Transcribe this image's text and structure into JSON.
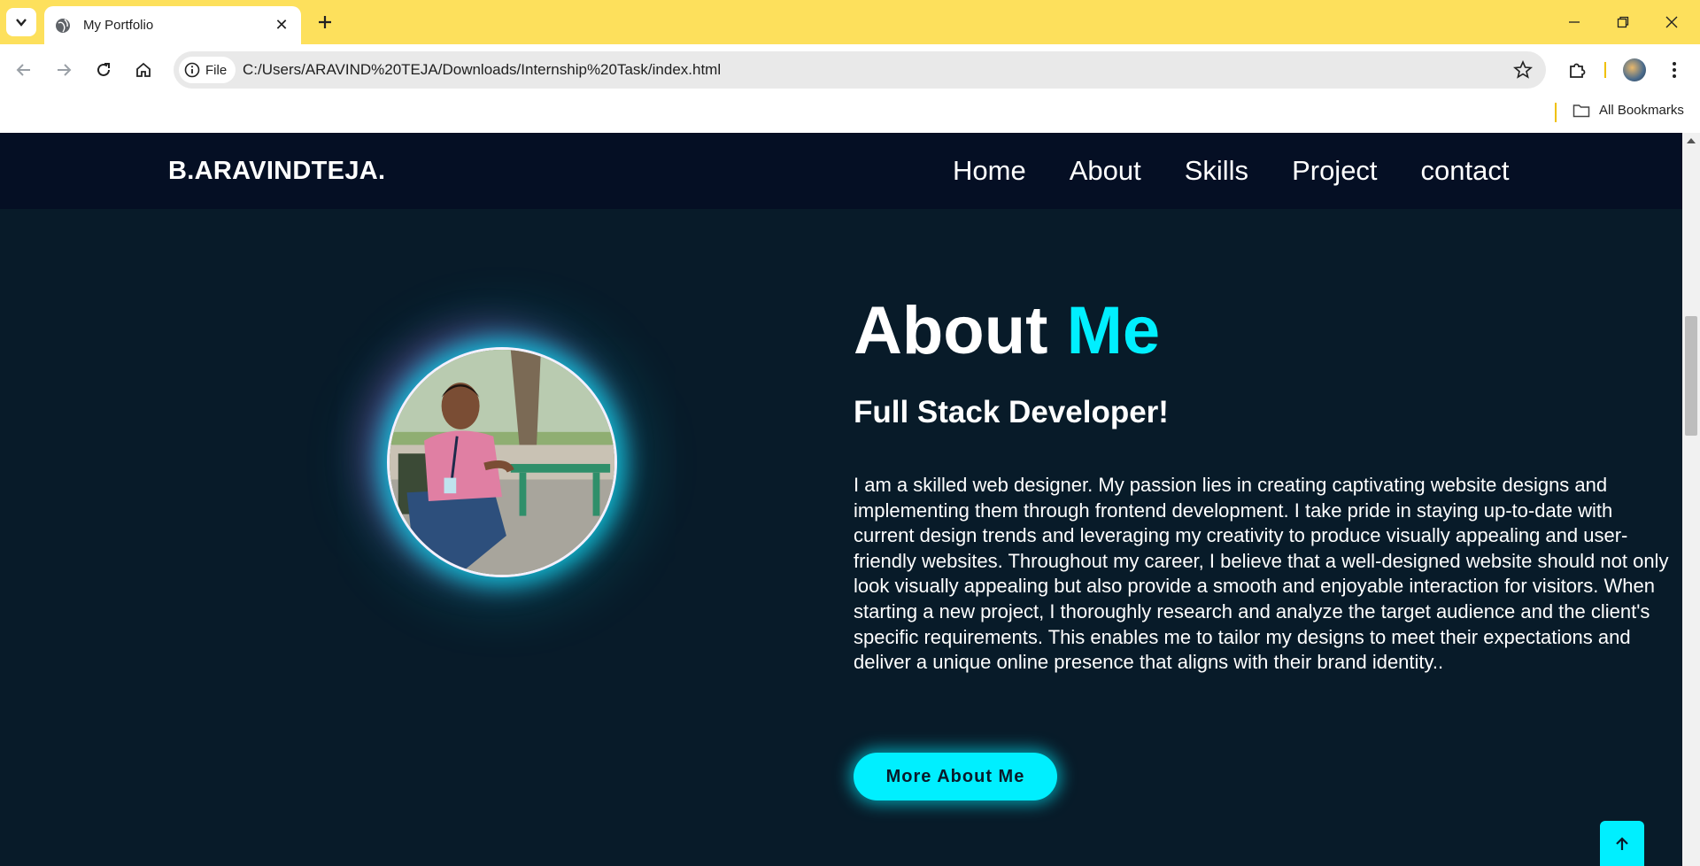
{
  "browser": {
    "tab_title": "My Portfolio",
    "url_chip": "File",
    "url": "C:/Users/ARAVIND%20TEJA/Downloads/Internship%20Task/index.html",
    "bookmarks_label": "All Bookmarks",
    "accent_color": "#fde05c"
  },
  "header": {
    "logo": "B.ARAVINDTEJA.",
    "nav": [
      "Home",
      "About",
      "Skills",
      "Project",
      "contact"
    ]
  },
  "about": {
    "title_main": "About ",
    "title_accent": "Me",
    "subtitle": "Full Stack Developer!",
    "paragraph": "I am a skilled web designer. My passion lies in creating captivating website designs and implementing them through frontend development. I take pride in staying up-to-date with current design trends and leveraging my creativity to produce visually appealing and user-friendly websites. Throughout my career, I believe that a well-designed website should not only look visually appealing but also provide a smooth and enjoyable interaction for visitors. When starting a new project, I thoroughly research and analyze the target audience and the client's specific requirements. This enables me to tailor my designs to meet their expectations and deliver a unique online presence that aligns with their brand identity..",
    "button_label": "More About Me"
  },
  "colors": {
    "page_bg": "#081b29",
    "header_bg": "#050f24",
    "accent": "#00efff"
  },
  "icons": {
    "scroll_top": "arrow-up-icon",
    "tab_search": "chevron-down-icon",
    "favicon": "globe-icon"
  }
}
